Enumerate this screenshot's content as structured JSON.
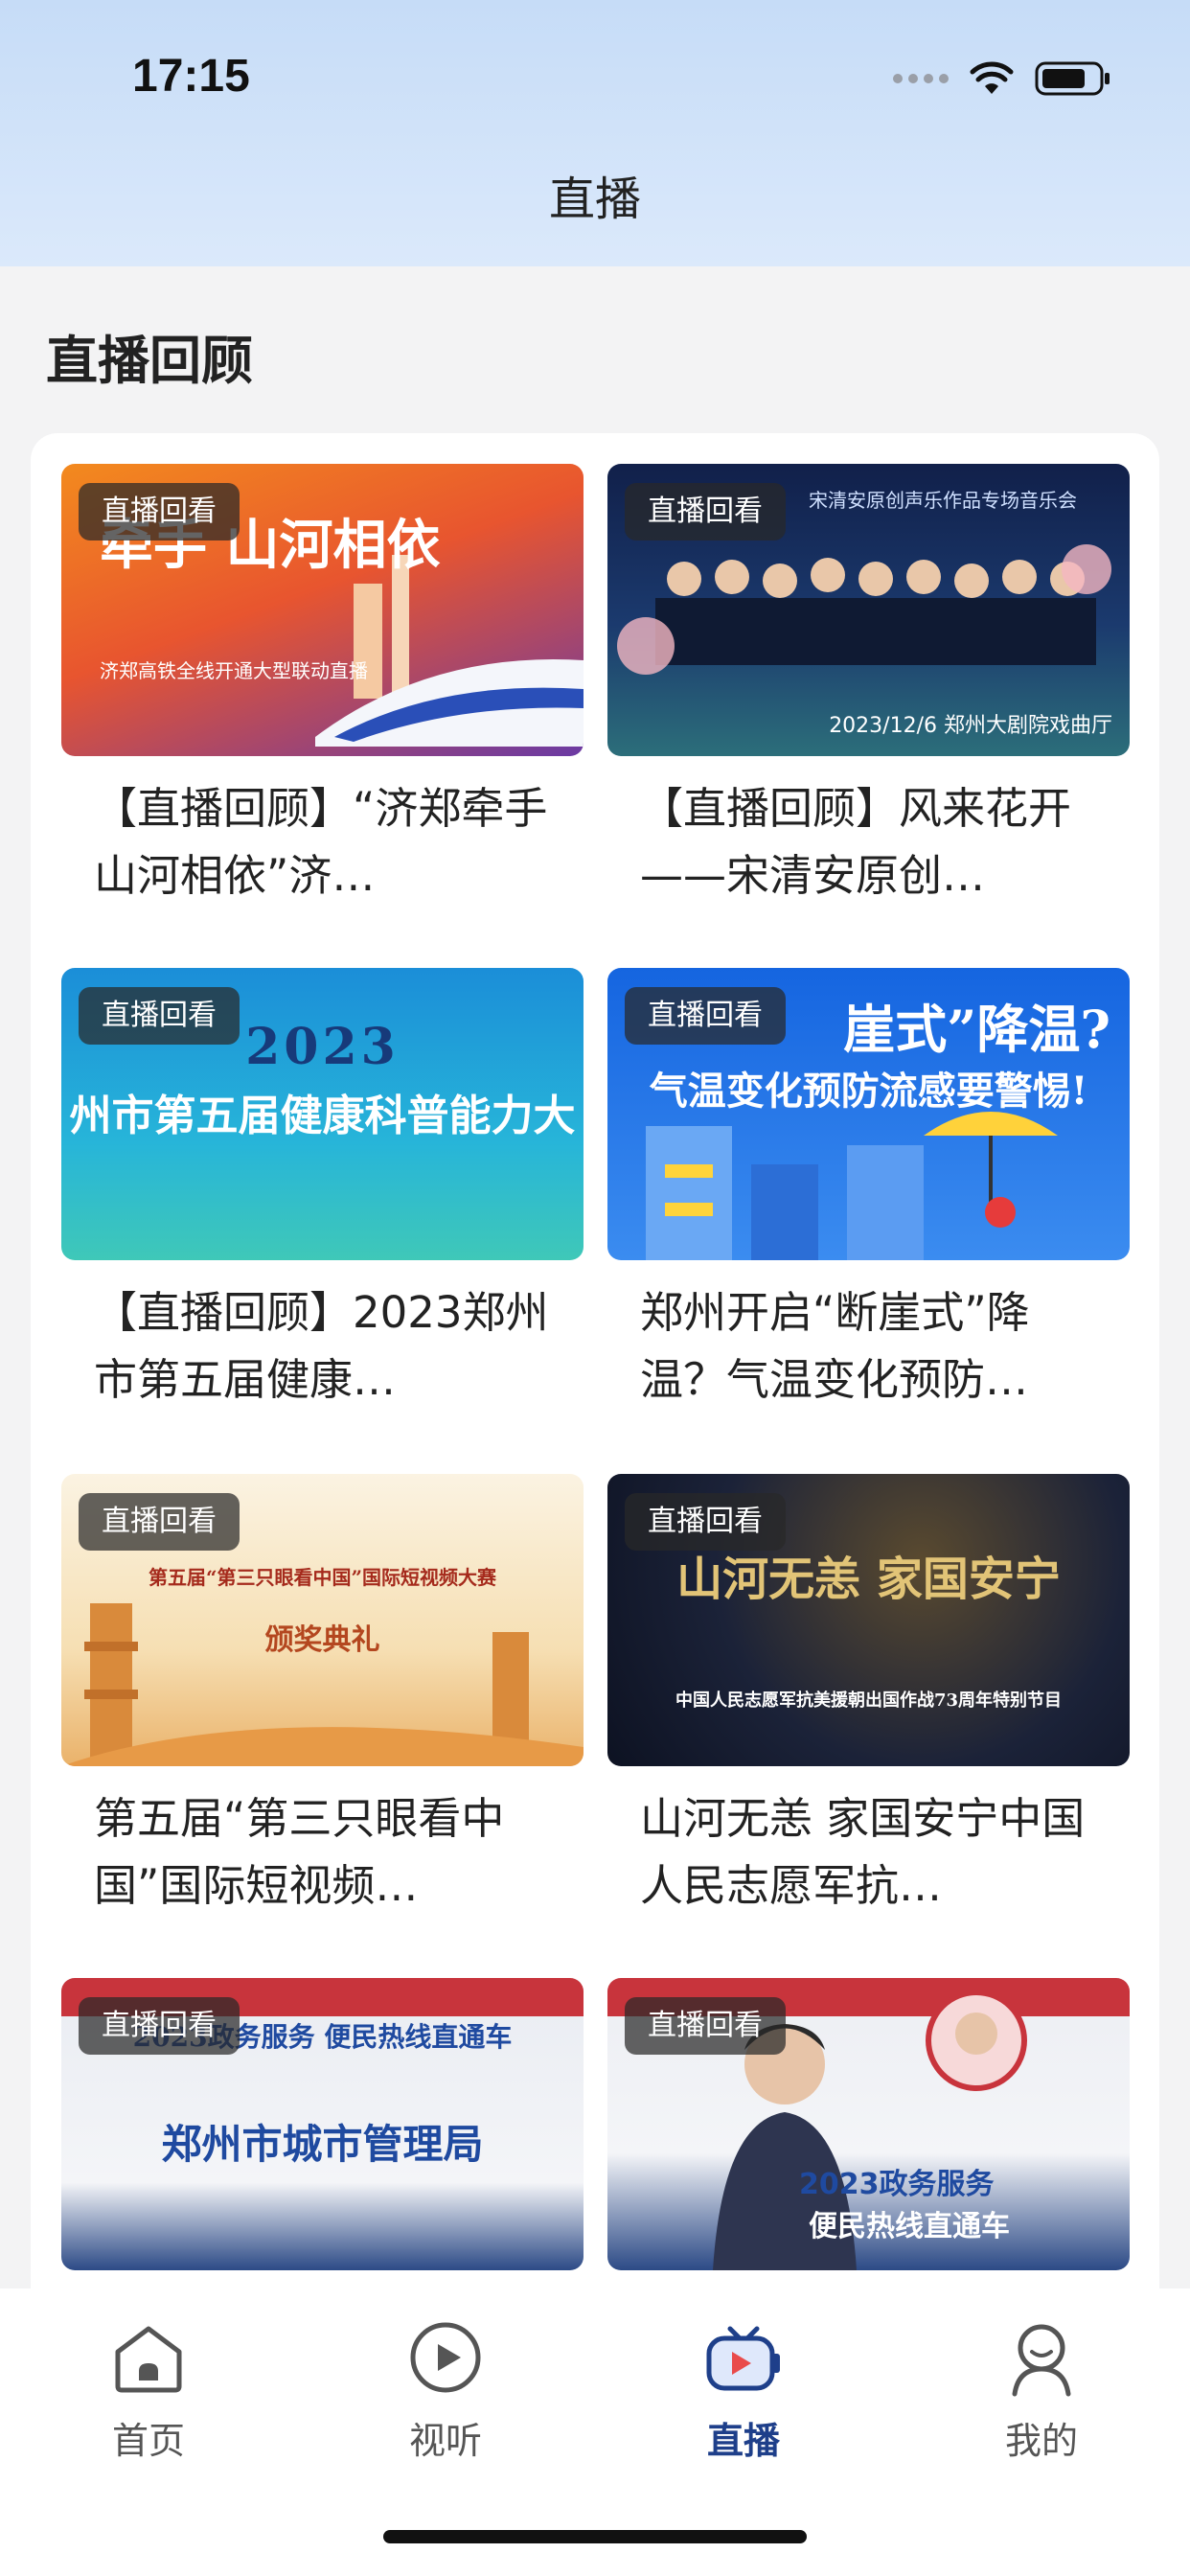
{
  "status_bar": {
    "time": "17:15"
  },
  "header": {
    "title": "直播"
  },
  "section": {
    "title": "直播回顾"
  },
  "tiles": [
    {
      "badge": "直播回看",
      "title": "【直播回顾】“济郑牵手 山河相依”济…",
      "art": "牵手 山河相依",
      "art_sub": "济郑高铁全线开通大型联动直播"
    },
    {
      "badge": "直播回看",
      "title": "【直播回顾】风来花开——宋清安原创…",
      "art": "2023/12/6 郑州大剧院戏曲厅",
      "art_sub": "宋清安原创声乐作品专场音乐会"
    },
    {
      "badge": "直播回看",
      "title": "【直播回顾】2023郑州市第五届健康…",
      "art": "2023",
      "art_sub": "州市第五届健康科普能力大"
    },
    {
      "badge": "直播回看",
      "title": "郑州开启“断崖式”降温？气温变化预防…",
      "art": "崖式”降温?",
      "art_sub": "气温变化预防流感要警惕!"
    },
    {
      "badge": "直播回看",
      "title": "第五届“第三只眼看中国”国际短视频…",
      "art": "第五届“第三只眼看中国”国际短视频大赛",
      "art_sub": "颁奖典礼"
    },
    {
      "badge": "直播回看",
      "title": "山河无恙 家国安宁中国人民志愿军抗…",
      "art": "山河无恙 家国安宁",
      "art_sub": "中国人民志愿军抗美援朝出国作战73周年特别节目"
    },
    {
      "badge": "直播回看",
      "title": "",
      "art": "郑州市城市管理局",
      "art_sub": "2023政务服务 便民热线直通车"
    },
    {
      "badge": "直播回看",
      "title": "",
      "art": "2023政务服务",
      "art_sub": "便民热线直通车"
    }
  ],
  "tabbar": {
    "items": [
      {
        "label": "首页",
        "icon": "home-icon"
      },
      {
        "label": "视听",
        "icon": "play-icon"
      },
      {
        "label": "直播",
        "icon": "live-tv-icon"
      },
      {
        "label": "我的",
        "icon": "profile-icon"
      }
    ],
    "active_color": "#1e3f8a",
    "live_accent": "#e94b4b"
  }
}
